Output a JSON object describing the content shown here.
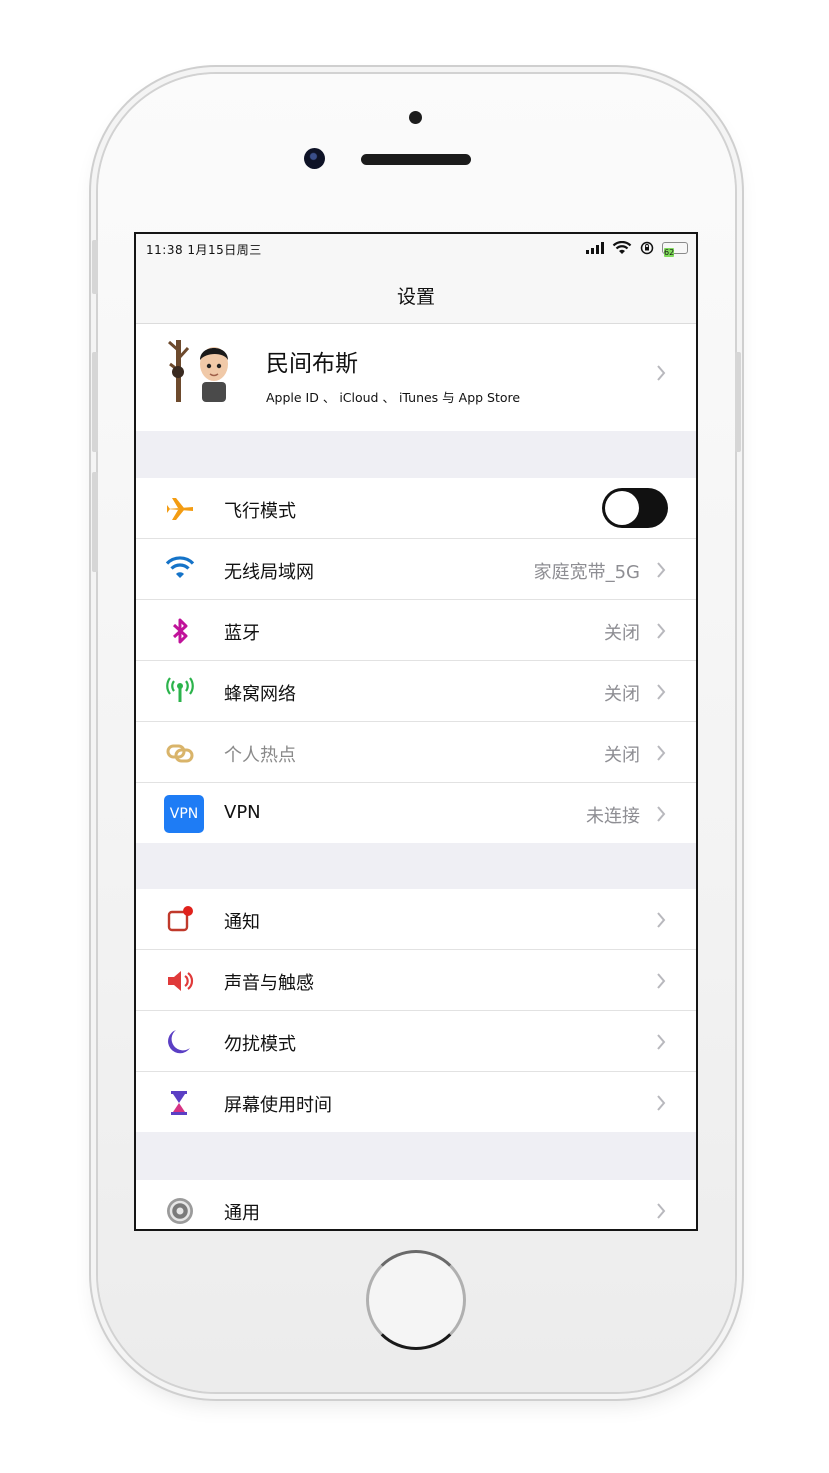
{
  "status_bar": {
    "time": "11:38  1月15日周三",
    "battery": "62"
  },
  "navbar": {
    "title": "设置"
  },
  "profile": {
    "name": "民间布斯",
    "subtitle": "Apple ID 、 iCloud 、 iTunes 与 App Store"
  },
  "network_group": [
    {
      "label": "飞行模式",
      "icon": "airplane-icon",
      "toggle": "off"
    },
    {
      "label": "无线局域网",
      "icon": "wifi-icon",
      "value": "家庭宽带_5G"
    },
    {
      "label": "蓝牙",
      "icon": "bluetooth-icon",
      "value": "关闭"
    },
    {
      "label": "蜂窝网络",
      "icon": "cellular-icon",
      "value": "关闭"
    },
    {
      "label": "个人热点",
      "icon": "hotspot-icon",
      "value": "关闭"
    },
    {
      "label": "VPN",
      "icon": "vpn-icon",
      "icon_text": "VPN",
      "value": "未连接"
    }
  ],
  "notify_group": [
    {
      "label": "通知",
      "icon": "notification-icon"
    },
    {
      "label": "声音与触感",
      "icon": "speaker-icon"
    },
    {
      "label": "勿扰模式",
      "icon": "moon-icon"
    },
    {
      "label": "屏幕使用时间",
      "icon": "hourglass-icon"
    }
  ],
  "general_group": [
    {
      "label": "通用",
      "icon": "gear-icon"
    }
  ],
  "colors": {
    "accent_blue": "#1e7cf5",
    "toggle_off": "#111111",
    "separator": "#efeff4"
  }
}
